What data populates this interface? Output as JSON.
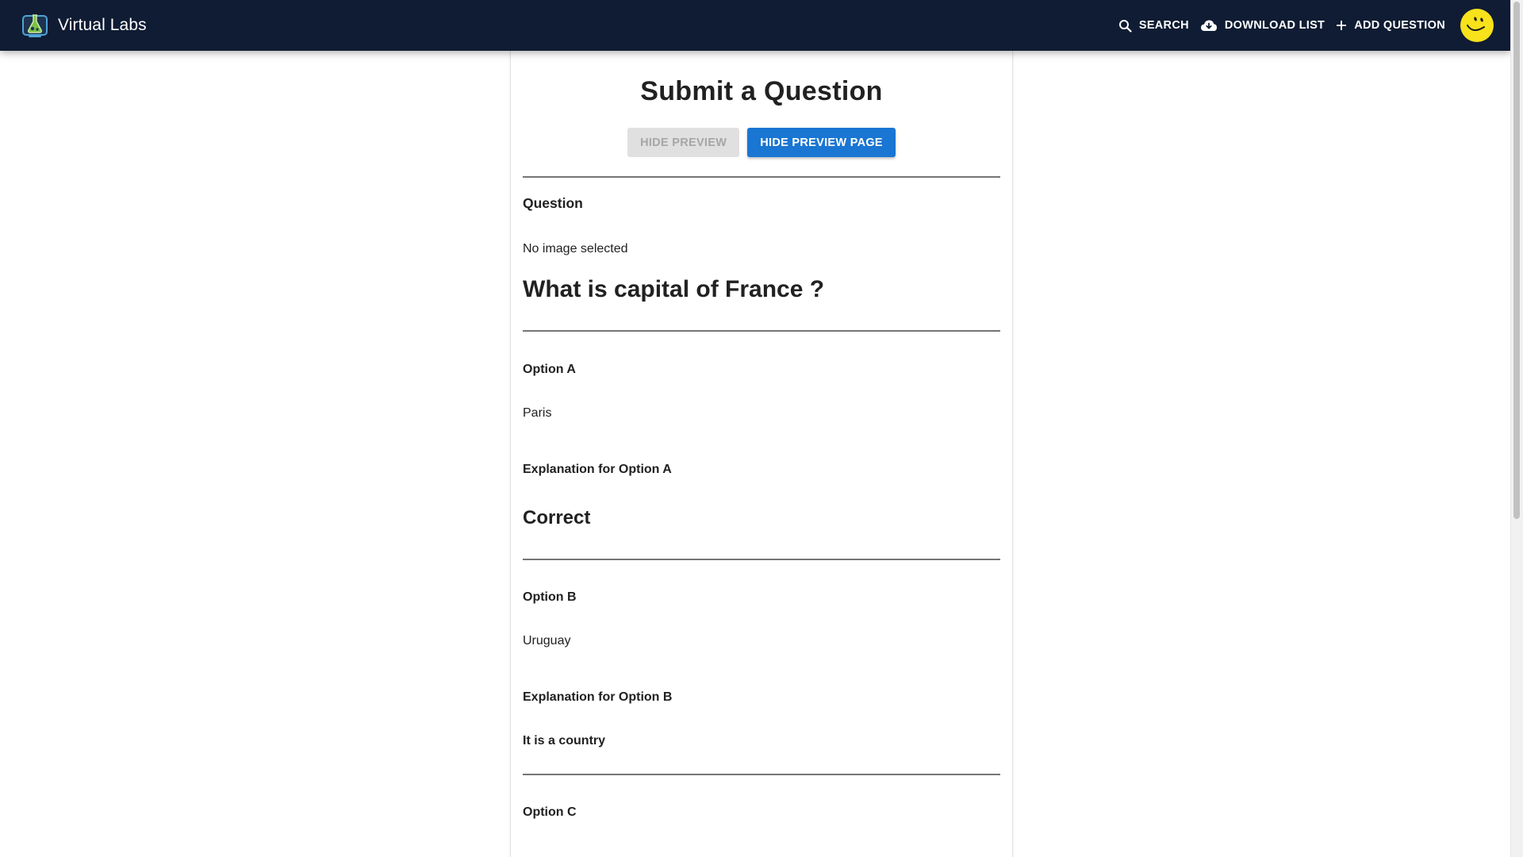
{
  "app": {
    "title": "Virtual Labs",
    "logo_icon": "flask-logo-icon"
  },
  "nav": {
    "search": {
      "label": "Search",
      "icon": "search-icon"
    },
    "download": {
      "label": "Download List",
      "icon": "cloud-download-icon"
    },
    "add": {
      "label": "Add Question",
      "icon": "plus-icon"
    },
    "avatar_icon": "smiley-avatar-icon"
  },
  "colors": {
    "appbar": "#0f1c33",
    "primary": "#1976d2",
    "avatar": "#f7e21b"
  },
  "page": {
    "title": "Submit a Question",
    "hide_preview_label": "Hide Preview",
    "hide_preview_page_label": "Hide Preview Page"
  },
  "question": {
    "section_label": "Question",
    "image_status": "No image selected",
    "text": "What is capital of France ?"
  },
  "options": [
    {
      "label": "Option A",
      "value": "Paris",
      "explanation_label": "Explanation for Option A",
      "explanation": "Correct"
    },
    {
      "label": "Option B",
      "value": "Uruguay",
      "explanation_label": "Explanation for Option B",
      "explanation": "It is a country"
    },
    {
      "label": "Option C"
    }
  ]
}
